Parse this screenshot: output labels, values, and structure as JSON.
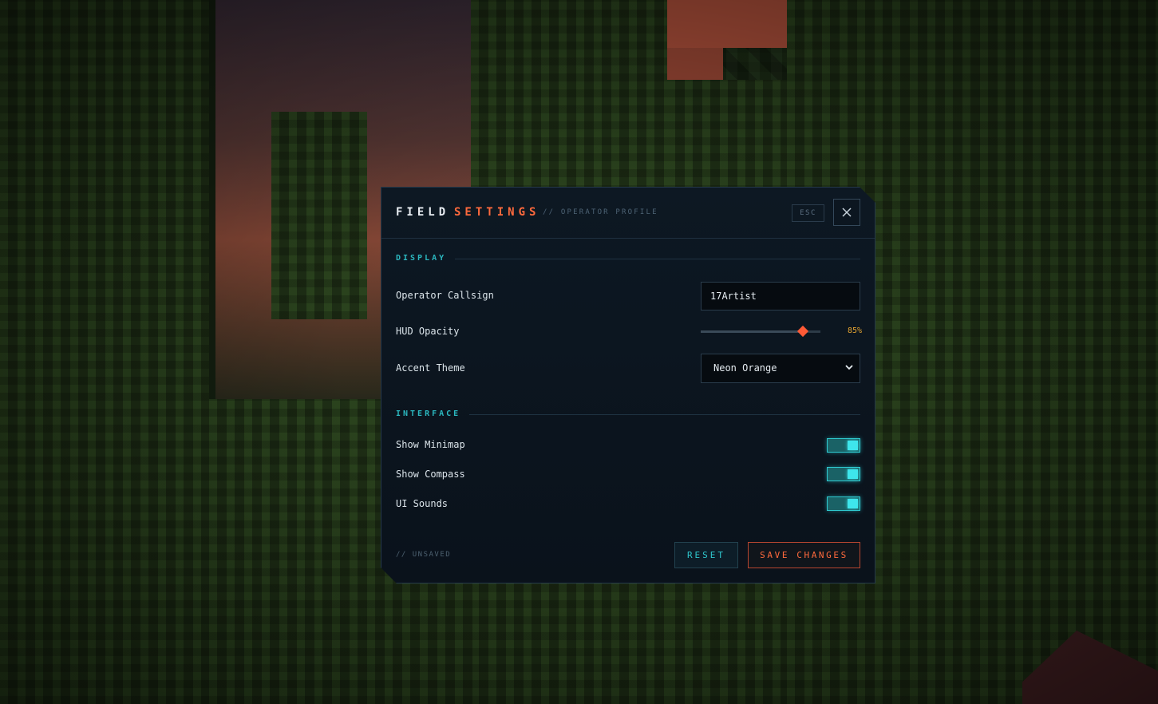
{
  "dialog": {
    "title_part1": "FIELD",
    "title_part2": "SETTINGS",
    "subtitle": "// OPERATOR PROFILE",
    "esc_hint": "ESC",
    "close_icon": "close-icon"
  },
  "display": {
    "section_label": "DISPLAY",
    "callsign_label": "Operator Callsign",
    "callsign_value": "17Artist",
    "opacity_label": "HUD Opacity",
    "opacity_value": 85,
    "opacity_text": "85%",
    "theme_label": "Accent Theme",
    "theme_value": "Neon Orange"
  },
  "interface": {
    "section_label": "INTERFACE",
    "toggles": [
      {
        "label": "Show Minimap",
        "on": true
      },
      {
        "label": "Show Compass",
        "on": true
      },
      {
        "label": "UI Sounds",
        "on": true
      }
    ]
  },
  "footer": {
    "status": "// UNSAVED",
    "reset_label": "RESET",
    "save_label": "SAVE CHANGES"
  },
  "colors": {
    "accent_orange": "#ff6a3d",
    "accent_cyan": "#2bb7bf",
    "value_amber": "#e6a531",
    "panel_bg": "#0d1823"
  }
}
